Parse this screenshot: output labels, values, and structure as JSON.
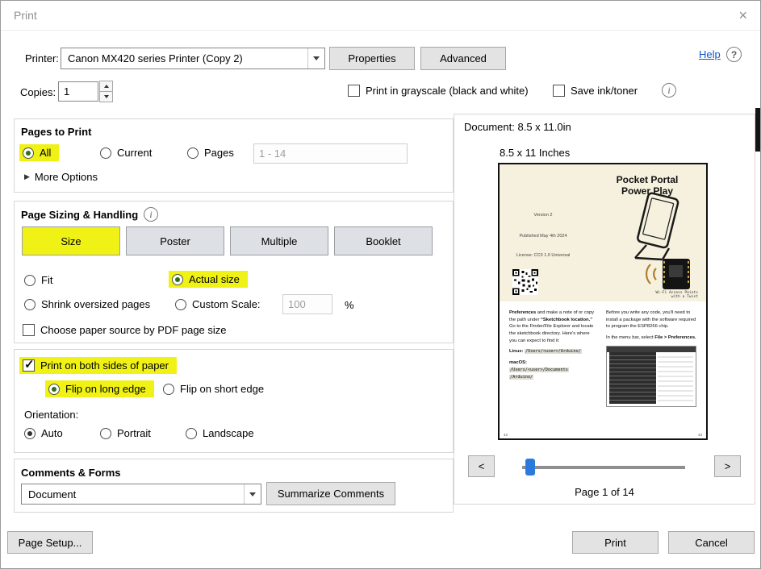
{
  "window": {
    "title": "Print",
    "close_icon": "×"
  },
  "printer": {
    "label": "Printer:",
    "value": "Canon MX420 series Printer (Copy 2)",
    "properties": "Properties",
    "advanced": "Advanced",
    "help": "Help",
    "help_icon": "?"
  },
  "copies": {
    "label": "Copies:",
    "value": "1",
    "grayscale": "Print in grayscale (black and white)",
    "save_ink": "Save ink/toner",
    "info_icon": "i"
  },
  "pages": {
    "title": "Pages to Print",
    "all": "All",
    "current": "Current",
    "pages": "Pages",
    "range": "1 - 14",
    "more_arrow": "▶",
    "more": "More Options"
  },
  "sizing": {
    "title": "Page Sizing & Handling",
    "info_icon": "i",
    "modes": [
      "Size",
      "Poster",
      "Multiple",
      "Booklet"
    ],
    "fit": "Fit",
    "actual": "Actual size",
    "shrink": "Shrink oversized pages",
    "custom": "Custom Scale:",
    "custom_value": "100",
    "percent": "%",
    "paper_source": "Choose paper source by PDF page size"
  },
  "duplex": {
    "both_sides": "Print on both sides of paper",
    "flip_long": "Flip on long edge",
    "flip_short": "Flip on short edge",
    "orientation": "Orientation:",
    "auto": "Auto",
    "portrait": "Portrait",
    "landscape": "Landscape"
  },
  "comments": {
    "title": "Comments & Forms",
    "value": "Document",
    "summarize": "Summarize Comments"
  },
  "preview": {
    "doc_size": "Document: 8.5 x 11.0in",
    "paper_size": "8.5 x 11 Inches",
    "prev": "<",
    "next": ">",
    "page_indicator": "Page 1 of 14",
    "page": {
      "title": "Pocket Portal\nPower Play",
      "version": "Version 2",
      "published": "Published May 4th 2024",
      "license": "License: CC0 1.0 Universal",
      "caption": "Wi-Fi Access Points\nwith a Twist",
      "col1_bold": "Preferences",
      "col1_text_a": " and make a note of or copy the path under ",
      "col1_bold2": "“Sketchbook location.”",
      "col1_text_b": " Go to the Finder/File Explorer and locate the sketchbook directory. Here's where you can expect to find it:",
      "linux_label": "Linux:",
      "linux_path": "/Users/<user>/Arduino/",
      "macos_label": "macOS:",
      "macos_path1": "/Users/<user>/Documents",
      "macos_path2": "/Arduino/",
      "col2_p1": "Before you write any code, you'll need to install a package with the software required to program the ESP8266 chip.",
      "col2_p2a": "In the menu bar, select ",
      "col2_p2b": "File > Preferences.",
      "footer_left": "42",
      "footer_right": "43"
    }
  },
  "footer": {
    "page_setup": "Page Setup...",
    "print": "Print",
    "cancel": "Cancel"
  },
  "colors": {
    "highlight": "#f0f215",
    "radio_dot": "#2e6e1e",
    "help_link": "#0b57d0",
    "slider_handle": "#2a7ade",
    "page_band": "#f6f1de"
  }
}
